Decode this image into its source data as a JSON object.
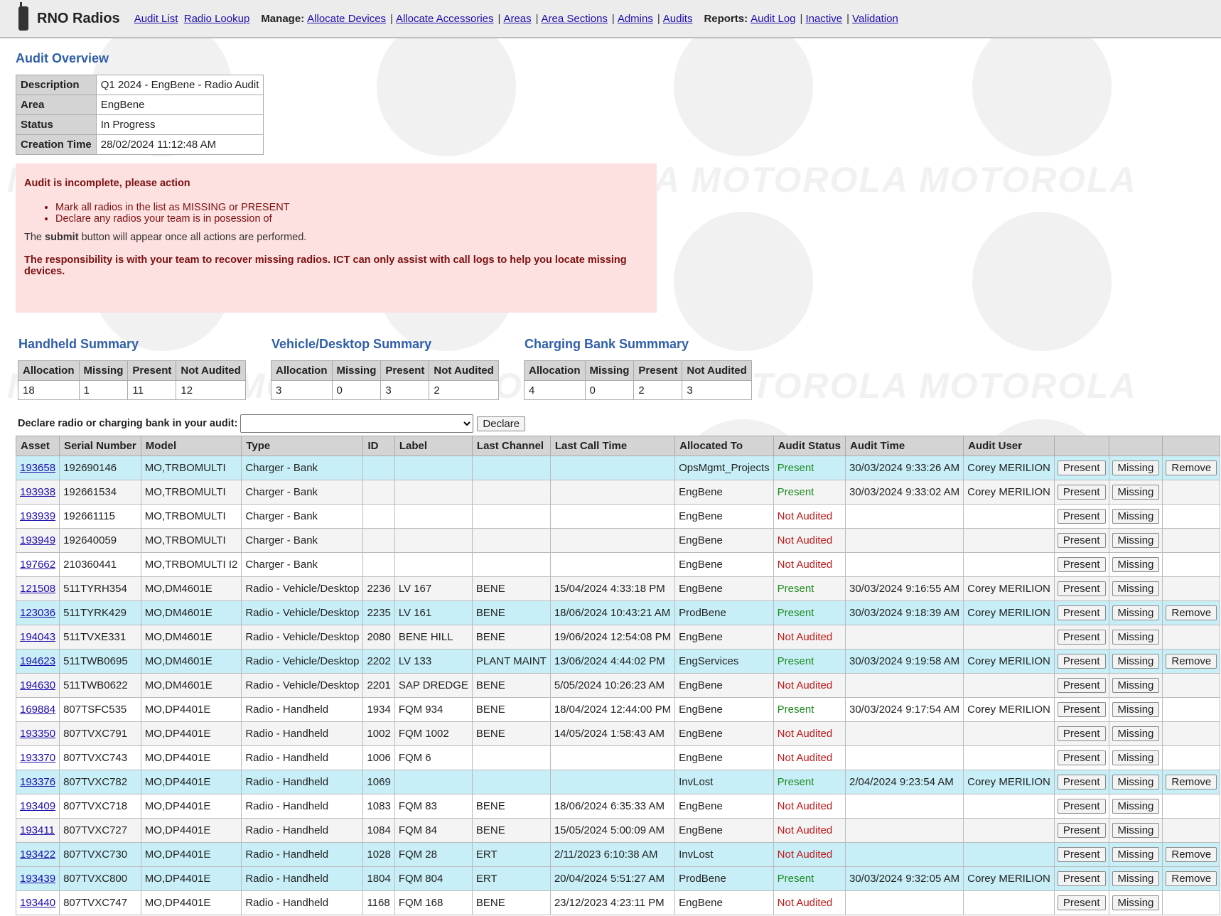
{
  "header": {
    "brand": "RNO Radios",
    "links": [
      "Audit List",
      "Radio Lookup"
    ],
    "manage_label": "Manage:",
    "manage": [
      "Allocate Devices",
      "Allocate Accessories",
      "Areas",
      "Area Sections",
      "Admins",
      "Audits"
    ],
    "reports_label": "Reports:",
    "reports": [
      "Audit Log",
      "Inactive",
      "Validation"
    ]
  },
  "watermark": "MOTOROLA",
  "overview": {
    "title": "Audit Overview",
    "rows": [
      {
        "k": "Description",
        "v": "Q1 2024 - EngBene - Radio Audit"
      },
      {
        "k": "Area",
        "v": "EngBene"
      },
      {
        "k": "Status",
        "v": "In Progress"
      },
      {
        "k": "Creation Time",
        "v": "28/02/2024 11:12:48 AM"
      }
    ]
  },
  "alert": {
    "title": "Audit is incomplete, please action",
    "items": [
      "Mark all radios in the list as MISSING or PRESENT",
      "Declare any radios your team is in posession of"
    ],
    "note_pre": "The ",
    "note_bold": "submit",
    "note_post": " button will appear once all actions are performed.",
    "responsibility": "The responsibility is with your team to recover missing radios. ICT can only assist with call logs to help you locate missing devices."
  },
  "summaries": [
    {
      "title": "Handheld Summary",
      "headers": [
        "Allocation",
        "Missing",
        "Present",
        "Not Audited"
      ],
      "values": [
        "18",
        "1",
        "11",
        "12"
      ]
    },
    {
      "title": "Vehicle/Desktop Summary",
      "headers": [
        "Allocation",
        "Missing",
        "Present",
        "Not Audited"
      ],
      "values": [
        "3",
        "0",
        "3",
        "2"
      ]
    },
    {
      "title": "Charging Bank Summmary",
      "headers": [
        "Allocation",
        "Missing",
        "Present",
        "Not Audited"
      ],
      "values": [
        "4",
        "0",
        "2",
        "3"
      ]
    }
  ],
  "declare": {
    "label": "Declare radio or charging bank in your audit:",
    "selected": "",
    "button": "Declare"
  },
  "table": {
    "headers": [
      "Asset",
      "Serial Number",
      "Model",
      "Type",
      "ID",
      "Label",
      "Last Channel",
      "Last Call Time",
      "Allocated To",
      "Audit Status",
      "Audit Time",
      "Audit User",
      "",
      "",
      ""
    ],
    "buttons": {
      "present": "Present",
      "missing": "Missing",
      "remove": "Remove"
    },
    "rows": [
      [
        "193658",
        "192690146",
        "MO,TRBOMULTI",
        "Charger - Bank",
        "",
        "",
        "",
        "",
        "OpsMgmt_Projects",
        "Present",
        "30/03/2024 9:33:26 AM",
        "Corey MERILION",
        true
      ],
      [
        "193938",
        "192661534",
        "MO,TRBOMULTI",
        "Charger - Bank",
        "",
        "",
        "",
        "",
        "EngBene",
        "Present",
        "30/03/2024 9:33:02 AM",
        "Corey MERILION",
        false
      ],
      [
        "193939",
        "192661115",
        "MO,TRBOMULTI",
        "Charger - Bank",
        "",
        "",
        "",
        "",
        "EngBene",
        "Not Audited",
        "",
        "",
        false
      ],
      [
        "193949",
        "192640059",
        "MO,TRBOMULTI",
        "Charger - Bank",
        "",
        "",
        "",
        "",
        "EngBene",
        "Not Audited",
        "",
        "",
        false
      ],
      [
        "197662",
        "210360441",
        "MO,TRBOMULTI I2",
        "Charger - Bank",
        "",
        "",
        "",
        "",
        "EngBene",
        "Not Audited",
        "",
        "",
        false
      ],
      [
        "121508",
        "511TYRH354",
        "MO,DM4601E",
        "Radio - Vehicle/Desktop",
        "2236",
        "LV 167",
        "BENE",
        "15/04/2024 4:33:18 PM",
        "EngBene",
        "Present",
        "30/03/2024 9:16:55 AM",
        "Corey MERILION",
        false
      ],
      [
        "123036",
        "511TYRK429",
        "MO,DM4601E",
        "Radio - Vehicle/Desktop",
        "2235",
        "LV 161",
        "BENE",
        "18/06/2024 10:43:21 AM",
        "ProdBene",
        "Present",
        "30/03/2024 9:18:39 AM",
        "Corey MERILION",
        true
      ],
      [
        "194043",
        "511TVXE331",
        "MO,DM4601E",
        "Radio - Vehicle/Desktop",
        "2080",
        "BENE HILL",
        "BENE",
        "19/06/2024 12:54:08 PM",
        "EngBene",
        "Not Audited",
        "",
        "",
        false
      ],
      [
        "194623",
        "511TWB0695",
        "MO,DM4601E",
        "Radio - Vehicle/Desktop",
        "2202",
        "LV 133",
        "PLANT MAINT",
        "13/06/2024 4:44:02 PM",
        "EngServices",
        "Present",
        "30/03/2024 9:19:58 AM",
        "Corey MERILION",
        true
      ],
      [
        "194630",
        "511TWB0622",
        "MO,DM4601E",
        "Radio - Vehicle/Desktop",
        "2201",
        "SAP DREDGE",
        "BENE",
        "5/05/2024 10:26:23 AM",
        "EngBene",
        "Not Audited",
        "",
        "",
        false
      ],
      [
        "169884",
        "807TSFC535",
        "MO,DP4401E",
        "Radio - Handheld",
        "1934",
        "FQM 934",
        "BENE",
        "18/04/2024 12:44:00 PM",
        "EngBene",
        "Present",
        "30/03/2024 9:17:54 AM",
        "Corey MERILION",
        false
      ],
      [
        "193350",
        "807TVXC791",
        "MO,DP4401E",
        "Radio - Handheld",
        "1002",
        "FQM 1002",
        "BENE",
        "14/05/2024 1:58:43 AM",
        "EngBene",
        "Not Audited",
        "",
        "",
        false
      ],
      [
        "193370",
        "807TVXC743",
        "MO,DP4401E",
        "Radio - Handheld",
        "1006",
        "FQM 6",
        "",
        "",
        "EngBene",
        "Not Audited",
        "",
        "",
        false
      ],
      [
        "193376",
        "807TVXC782",
        "MO,DP4401E",
        "Radio - Handheld",
        "1069",
        "",
        "",
        "",
        "InvLost",
        "Present",
        "2/04/2024 9:23:54 AM",
        "Corey MERILION",
        true
      ],
      [
        "193409",
        "807TVXC718",
        "MO,DP4401E",
        "Radio - Handheld",
        "1083",
        "FQM 83",
        "BENE",
        "18/06/2024 6:35:33 AM",
        "EngBene",
        "Not Audited",
        "",
        "",
        false
      ],
      [
        "193411",
        "807TVXC727",
        "MO,DP4401E",
        "Radio - Handheld",
        "1084",
        "FQM 84",
        "BENE",
        "15/05/2024 5:00:09 AM",
        "EngBene",
        "Not Audited",
        "",
        "",
        false
      ],
      [
        "193422",
        "807TVXC730",
        "MO,DP4401E",
        "Radio - Handheld",
        "1028",
        "FQM 28",
        "ERT",
        "2/11/2023 6:10:38 AM",
        "InvLost",
        "Not Audited",
        "",
        "",
        true
      ],
      [
        "193439",
        "807TVXC800",
        "MO,DP4401E",
        "Radio - Handheld",
        "1804",
        "FQM 804",
        "ERT",
        "20/04/2024 5:51:27 AM",
        "ProdBene",
        "Present",
        "30/03/2024 9:32:05 AM",
        "Corey MERILION",
        true
      ],
      [
        "193440",
        "807TVXC747",
        "MO,DP4401E",
        "Radio - Handheld",
        "1168",
        "FQM 168",
        "BENE",
        "23/12/2023 4:23:11 PM",
        "EngBene",
        "Not Audited",
        "",
        "",
        false
      ]
    ]
  },
  "colors": {
    "title_blue": "#2f5fa8",
    "present_green": "#1e8a1e",
    "not_audited_red": "#c01818",
    "other_area_row": "#c8eff7",
    "alert_bg": "#fde0e0"
  }
}
